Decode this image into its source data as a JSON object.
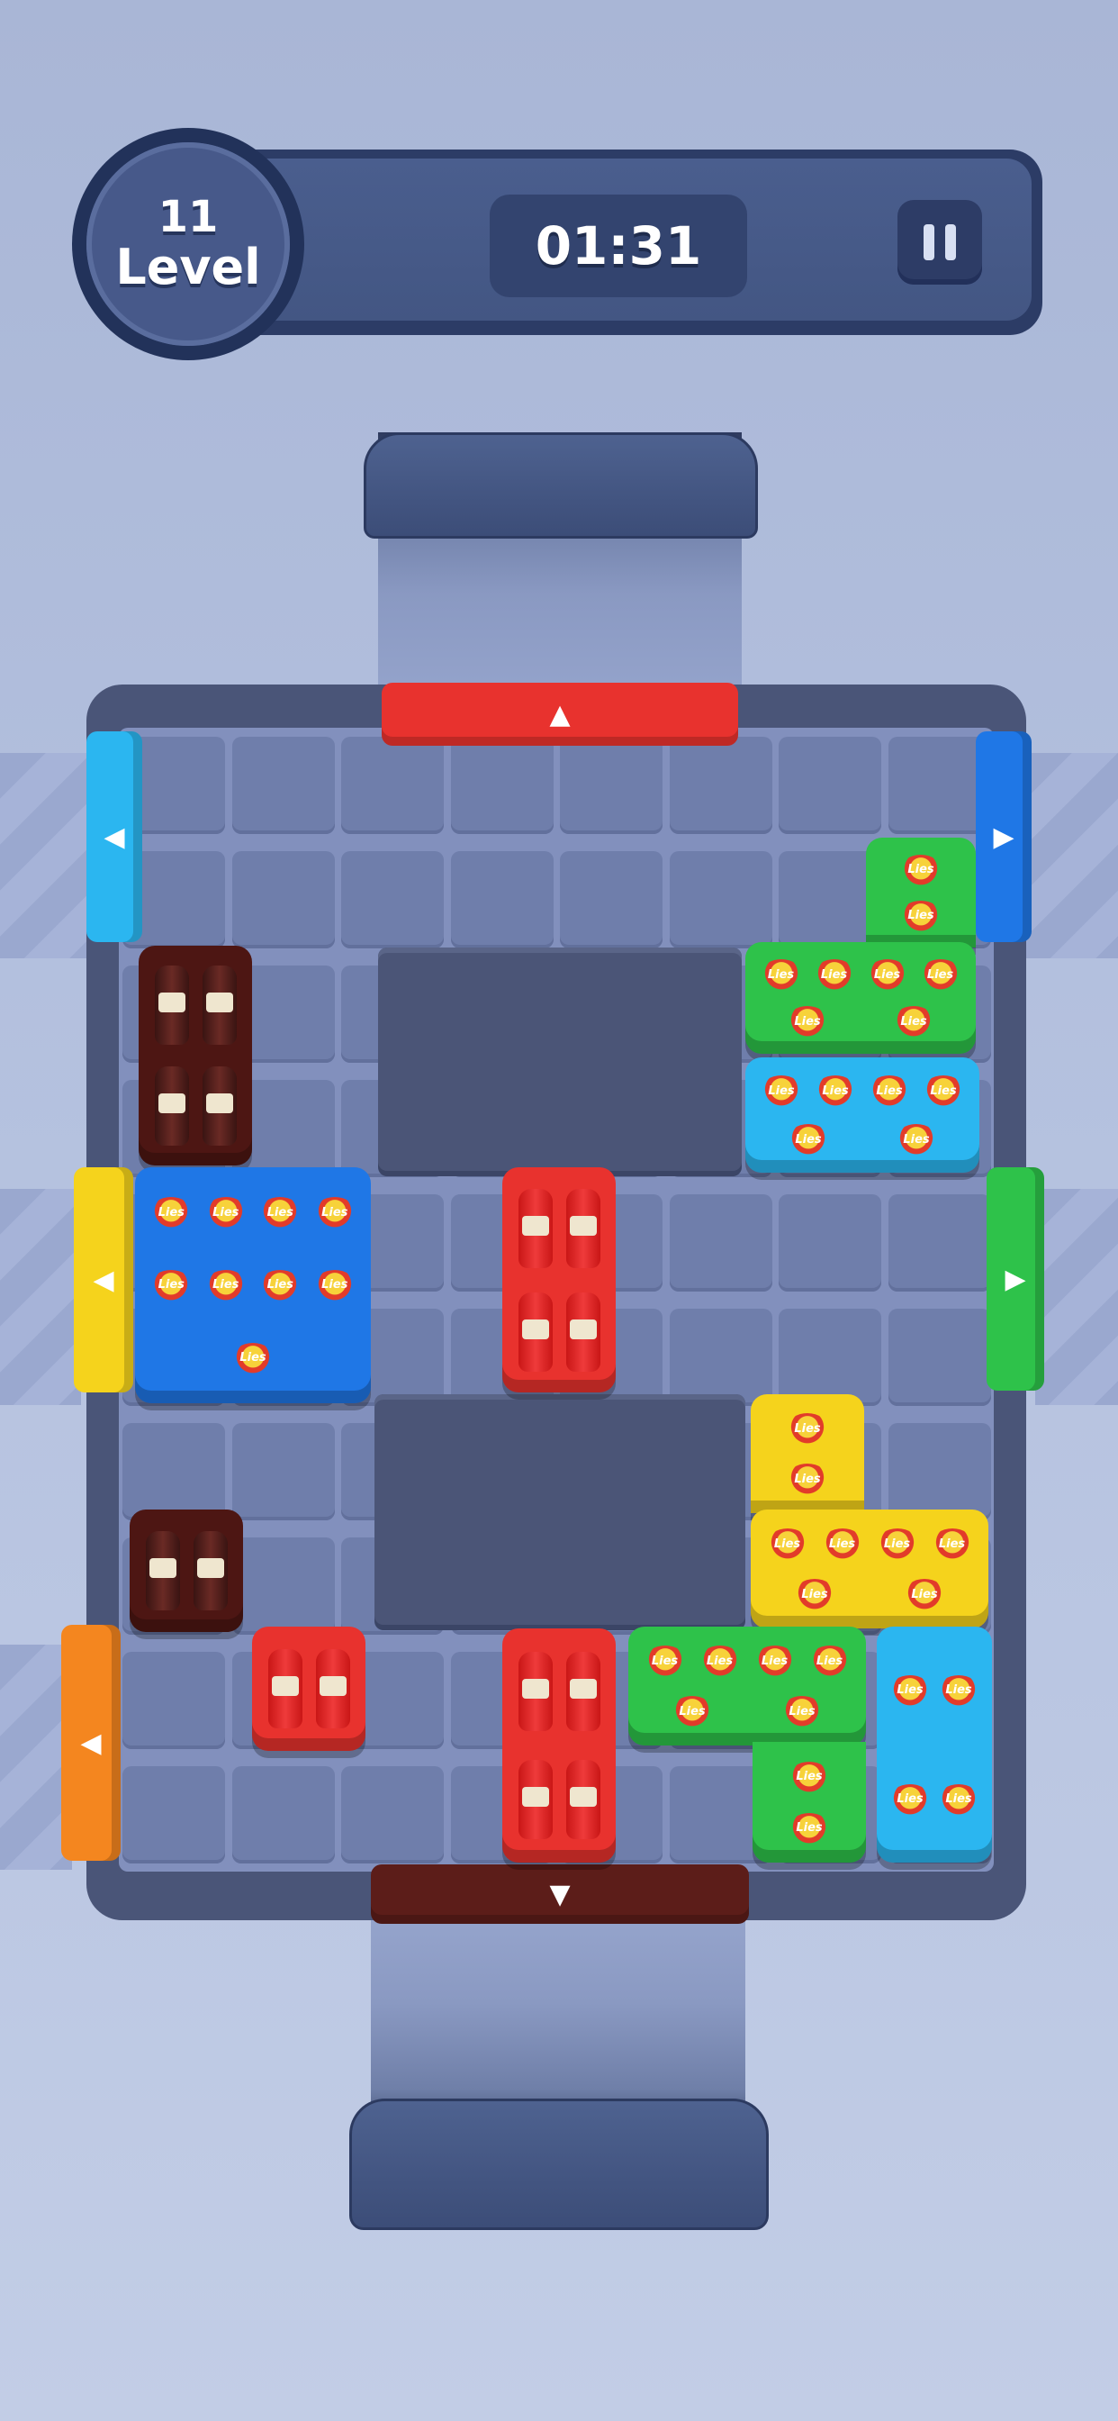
{
  "hud": {
    "level_number": "11",
    "level_word": "Level",
    "timer": "01:31",
    "pause_icon": "pause-icon"
  },
  "gates": {
    "top_red_arrow": "▲",
    "bottom_brown_arrow": "▼",
    "left_lightblue_arrow": "◀",
    "left_yellow_arrow": "◀",
    "left_orange_arrow": "◀",
    "right_blue_arrow": "▶",
    "right_green_arrow": "▶"
  },
  "colors": {
    "red": "#e8322e",
    "brown": "#5c1d19",
    "light_blue": "#2bb6f0",
    "blue": "#1f77e6",
    "green": "#2ec24a",
    "yellow": "#f5d31c",
    "orange": "#f4861f"
  },
  "blocks": {
    "chip_brand": "Lies",
    "bottle_brand": "HEINZ"
  }
}
